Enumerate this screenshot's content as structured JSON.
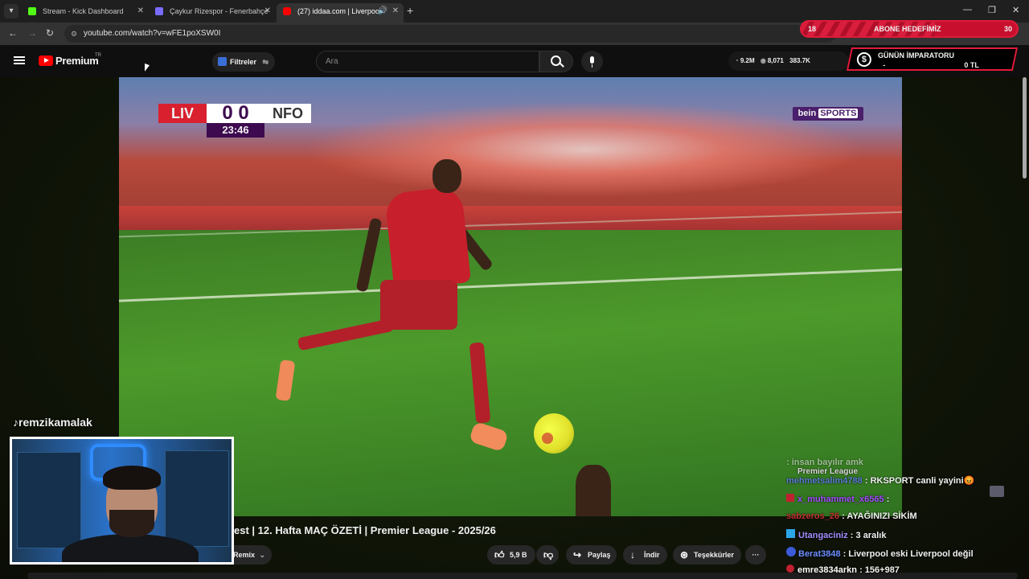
{
  "browser": {
    "tabs": [
      {
        "label": "Stream - Kick Dashboard",
        "fav_color": "#53fc18"
      },
      {
        "label": "Çaykur Rizespor - Fenerbahçe",
        "fav_color": "#7a6cff"
      },
      {
        "label": "(27) iddaa.com | Liverpool",
        "fav_color": "#ff0000"
      }
    ],
    "url": "youtube.com/watch?v=wFE1poXSW0I"
  },
  "sub_goal": {
    "current": "18",
    "title": "ABONE HEDEFİMİZ",
    "target": "30"
  },
  "youtube": {
    "brand": "Premium",
    "country": "TR",
    "filters_label": "Filtreler",
    "search_placeholder": "Ara",
    "stats": {
      "a": "9.2M",
      "b": "8,071",
      "c": "383.7K"
    }
  },
  "emperor": {
    "title": "GÜNÜN İMPARATORU",
    "name": "-",
    "amount": "0 TL",
    "coin": "$"
  },
  "scoreboard": {
    "home": "LIV",
    "score": "0 0",
    "away": "NFO",
    "clock": "23:46"
  },
  "broadcaster": {
    "a": "bein",
    "b": "SPORTS"
  },
  "video_title": "est | 12. Hafta MAÇ ÖZETİ | Premier League - 2025/26",
  "actions": {
    "remix": "Remix",
    "likes": "5,9 B",
    "share": "Paylaş",
    "download": "İndir",
    "thanks": "Teşekkürler",
    "more": "···"
  },
  "streamer": {
    "handle": "remzikamalak"
  },
  "premier_badge": "Premier League",
  "chat": [
    {
      "user": "",
      "text": ": insan bayılır amk",
      "color": "#8aa0b0"
    },
    {
      "user": "mehmetsalim4788",
      "text": ": RKSPORT canli yayini😡",
      "color": "#5b7bd6"
    },
    {
      "user": "x_muhammet_x6565",
      "text": ":",
      "color": "#a24cff"
    },
    {
      "user": "sabzeros_26",
      "text": ": AYAĞINIZI SİKİM",
      "color": "#c03030"
    },
    {
      "user": "Utangaciniz",
      "text": ": 3 aralık",
      "color": "#a28cff"
    },
    {
      "user": "Berat3848",
      "text": ": Liverpool eski Liverpool değil",
      "color": "#6c8cff"
    },
    {
      "user": "emre3834arkn",
      "text": ": 156+987",
      "color": "#ffffff"
    }
  ]
}
